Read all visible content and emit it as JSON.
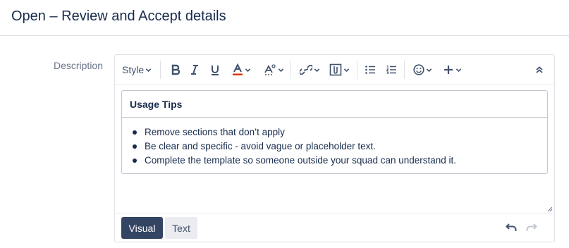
{
  "header": {
    "title": "Open – Review and Accept details"
  },
  "field": {
    "label": "Description"
  },
  "toolbar": {
    "style_label": "Style",
    "items": [
      "bold-icon",
      "italic-icon",
      "underline-icon",
      "text-color-icon",
      "text-effects-icon",
      "link-icon",
      "attachment-icon",
      "bullet-list-icon",
      "numbered-list-icon",
      "emoji-icon",
      "insert-more-icon",
      "collapse-toolbar-icon"
    ],
    "text_color": "#de350b"
  },
  "panel": {
    "title": "Usage Tips",
    "items": [
      "Remove sections that don’t apply",
      "Be clear and specific - avoid vague or placeholder text.",
      "Complete the template so someone outside your squad can understand it."
    ]
  },
  "footer": {
    "visual_label": "Visual",
    "text_label": "Text"
  },
  "colors": {
    "primary_button": "#344563",
    "text": "#172b4d",
    "muted": "#6b778c",
    "border": "#dfe1e6"
  }
}
